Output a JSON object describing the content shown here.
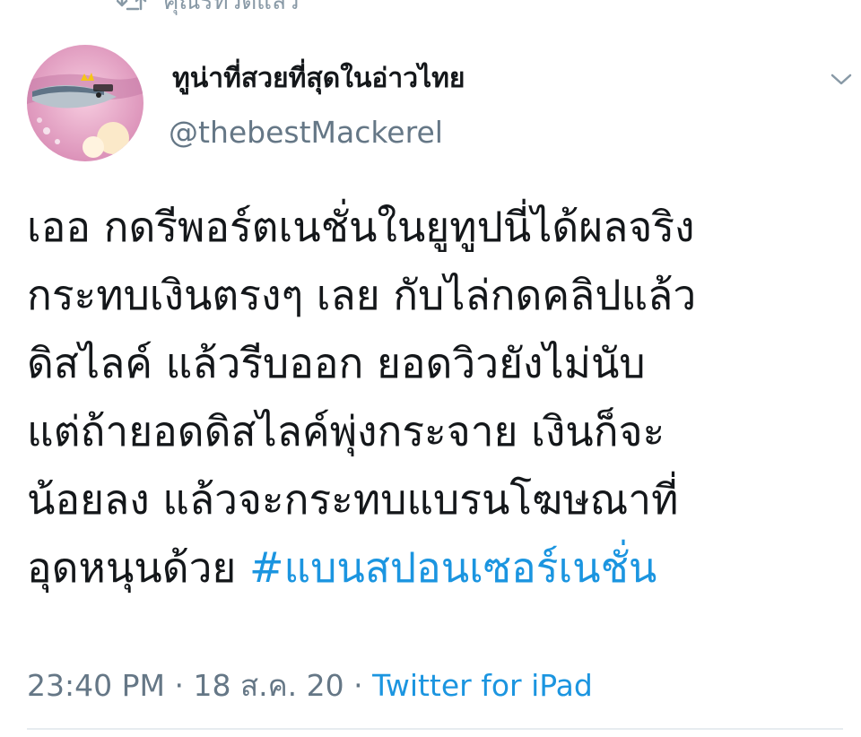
{
  "retweet": {
    "text": "คุณรีทวีตแล้ว",
    "icon": "retweet-icon"
  },
  "author": {
    "display_name": "ทูน่าที่สวยที่สุดในอ่าวไทย",
    "handle": "@thebestMackerel",
    "avatar": "mackerel-avatar"
  },
  "tweet": {
    "lines": [
      "เออ กดรีพอร์ตเนชั่นในยูทูปนี่ได้ผลจริง",
      "กระทบเงินตรงๆ เลย กับไล่กดคลิปแล้ว",
      "ดิสไลค์ แล้วรีบออก ยอดวิวยังไม่นับ",
      "แต่ถ้ายอดดิสไลค์พุ่งกระจาย เงินก็จะ",
      "น้อยลง  แล้วจะกระทบแบรนโฆษณาที่",
      "อุดหนุนด้วย "
    ],
    "hashtag": "#แบนสปอนเซอร์เนชั่น"
  },
  "meta": {
    "time": "23:40 PM",
    "separator": "·",
    "date": "18 ส.ค. 20",
    "source": "Twitter for iPad"
  },
  "colors": {
    "link": "#1b95e0",
    "secondary_text": "#657786",
    "primary_text": "#14171a"
  }
}
